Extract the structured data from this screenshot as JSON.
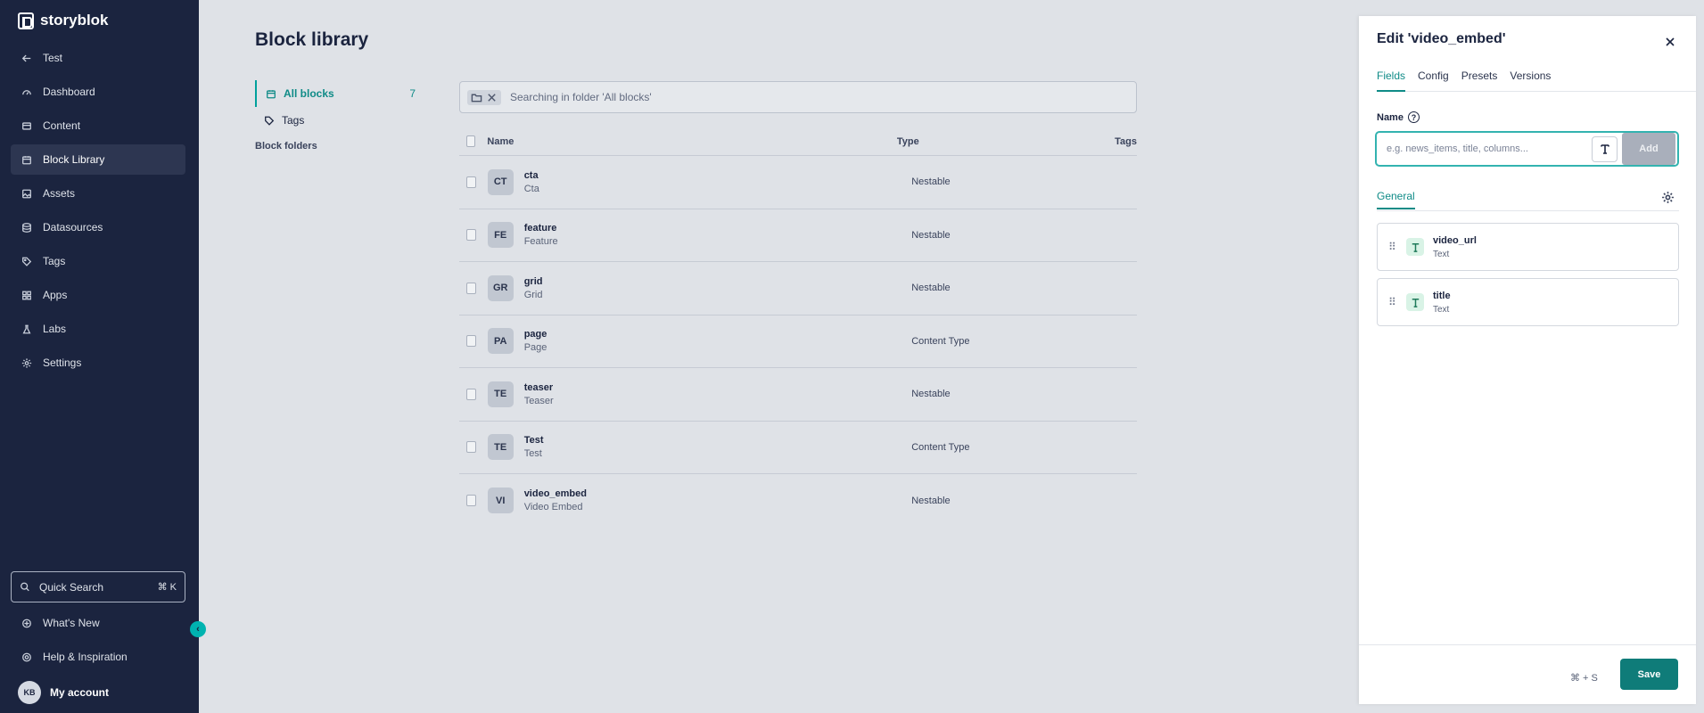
{
  "app": {
    "logo_text": "storyblok"
  },
  "sidebar": {
    "items": [
      {
        "label": "Test",
        "icon": "arrow-left-icon",
        "active": false
      },
      {
        "label": "Dashboard",
        "icon": "dashboard-icon",
        "active": false
      },
      {
        "label": "Content",
        "icon": "content-icon",
        "active": false
      },
      {
        "label": "Block Library",
        "icon": "block-library-icon",
        "active": true
      },
      {
        "label": "Assets",
        "icon": "assets-icon",
        "active": false
      },
      {
        "label": "Datasources",
        "icon": "database-icon",
        "active": false
      },
      {
        "label": "Tags",
        "icon": "tag-icon",
        "active": false
      },
      {
        "label": "Apps",
        "icon": "apps-icon",
        "active": false
      },
      {
        "label": "Labs",
        "icon": "flask-icon",
        "active": false
      },
      {
        "label": "Settings",
        "icon": "gear-icon",
        "active": false
      }
    ],
    "quick_search": {
      "label": "Quick Search",
      "shortcut": "⌘ K"
    },
    "whats_new": "What's New",
    "help": "Help & Inspiration",
    "account": {
      "initials": "KB",
      "label": "My account"
    }
  },
  "main": {
    "title": "Block library",
    "folders": {
      "all_blocks": {
        "label": "All blocks",
        "count": "7"
      },
      "tags": "Tags",
      "block_folders_title": "Block folders"
    },
    "search_text": "Searching in folder 'All blocks'",
    "table": {
      "headers": {
        "name": "Name",
        "type": "Type",
        "tags": "Tags"
      },
      "rows": [
        {
          "badge": "CT",
          "name": "cta",
          "display": "Cta",
          "type": "Nestable"
        },
        {
          "badge": "FE",
          "name": "feature",
          "display": "Feature",
          "type": "Nestable"
        },
        {
          "badge": "GR",
          "name": "grid",
          "display": "Grid",
          "type": "Nestable"
        },
        {
          "badge": "PA",
          "name": "page",
          "display": "Page",
          "type": "Content Type"
        },
        {
          "badge": "TE",
          "name": "teaser",
          "display": "Teaser",
          "type": "Nestable"
        },
        {
          "badge": "TE",
          "name": "Test",
          "display": "Test",
          "type": "Content Type"
        },
        {
          "badge": "VI",
          "name": "video_embed",
          "display": "Video Embed",
          "type": "Nestable"
        }
      ]
    }
  },
  "panel": {
    "title": "Edit 'video_embed'",
    "tabs": [
      {
        "label": "Fields",
        "active": true
      },
      {
        "label": "Config",
        "active": false
      },
      {
        "label": "Presets",
        "active": false
      },
      {
        "label": "Versions",
        "active": false
      }
    ],
    "name_label": "Name",
    "name_input": {
      "value": "",
      "placeholder": "e.g. news_items, title, columns..."
    },
    "add_label": "Add",
    "general_tab": "General",
    "fields": [
      {
        "name": "video_url",
        "type": "Text"
      },
      {
        "name": "title",
        "type": "Text"
      }
    ],
    "shortcut": "⌘ + S",
    "save_label": "Save"
  },
  "colors": {
    "sidebar_bg": "#1b243f",
    "accent": "#0f8b87",
    "save_button": "#0f7c79"
  }
}
